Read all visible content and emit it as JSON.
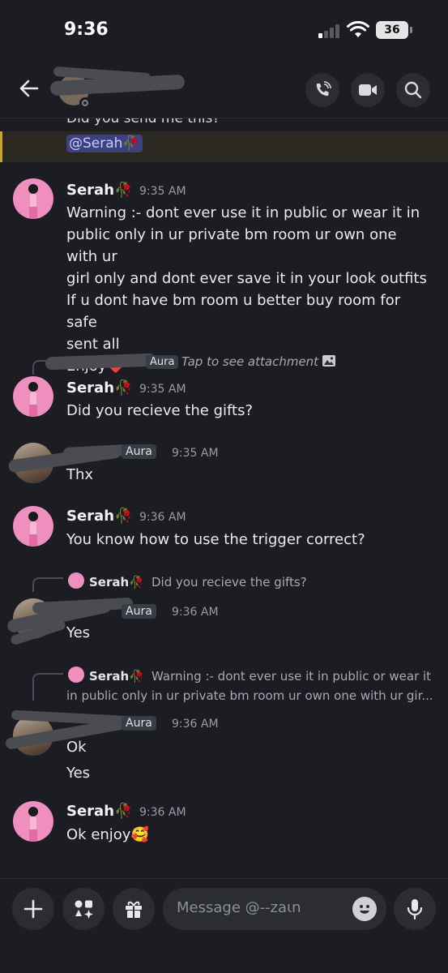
{
  "status_bar": {
    "time": "9:36",
    "battery": "36"
  },
  "header": {
    "icons": [
      "back-arrow-icon",
      "phone-call-icon",
      "video-camera-icon",
      "search-icon"
    ]
  },
  "partial_message": {
    "text": "Did you send me this?",
    "mention": "@Serah🥀"
  },
  "messages": [
    {
      "author": "Serah🥀",
      "time": "9:35 AM",
      "lines": [
        "Warning :- dont ever use it in public or wear it in",
        "public only in ur private bm room ur own one with ur",
        "girl only and dont ever save it in your look outfits",
        "If u dont have bm room u better buy room for safe",
        "sent all",
        "Enjoy❤️"
      ]
    },
    {
      "reply": {
        "tag": "Aura",
        "text": "Tap to see attachment"
      },
      "author": "Serah🥀",
      "time": "9:35 AM",
      "lines": [
        "Did you recieve the gifts?"
      ]
    },
    {
      "tag": "Aura",
      "time": "9:35 AM",
      "lines": [
        "Thx"
      ]
    },
    {
      "author": "Serah🥀",
      "time": "9:36 AM",
      "lines": [
        "You know how to use the trigger correct?"
      ]
    },
    {
      "reply": {
        "author": "Serah🥀",
        "text": "Did you recieve the gifts?"
      },
      "tag": "Aura",
      "time": "9:36 AM",
      "lines": [
        "Yes"
      ]
    },
    {
      "reply": {
        "author": "Serah🥀",
        "text": "Warning :- dont ever use it in public or wear it",
        "text2": "in public only in ur private bm room ur own one with ur gir..."
      },
      "tag": "Aura",
      "time": "9:36 AM",
      "lines": [
        "Ok",
        "Yes"
      ]
    },
    {
      "author": "Serah🥀",
      "time": "9:36 AM",
      "lines": [
        "Ok enjoy🥰"
      ]
    }
  ],
  "composer": {
    "placeholder": "Message @--zaιn"
  }
}
